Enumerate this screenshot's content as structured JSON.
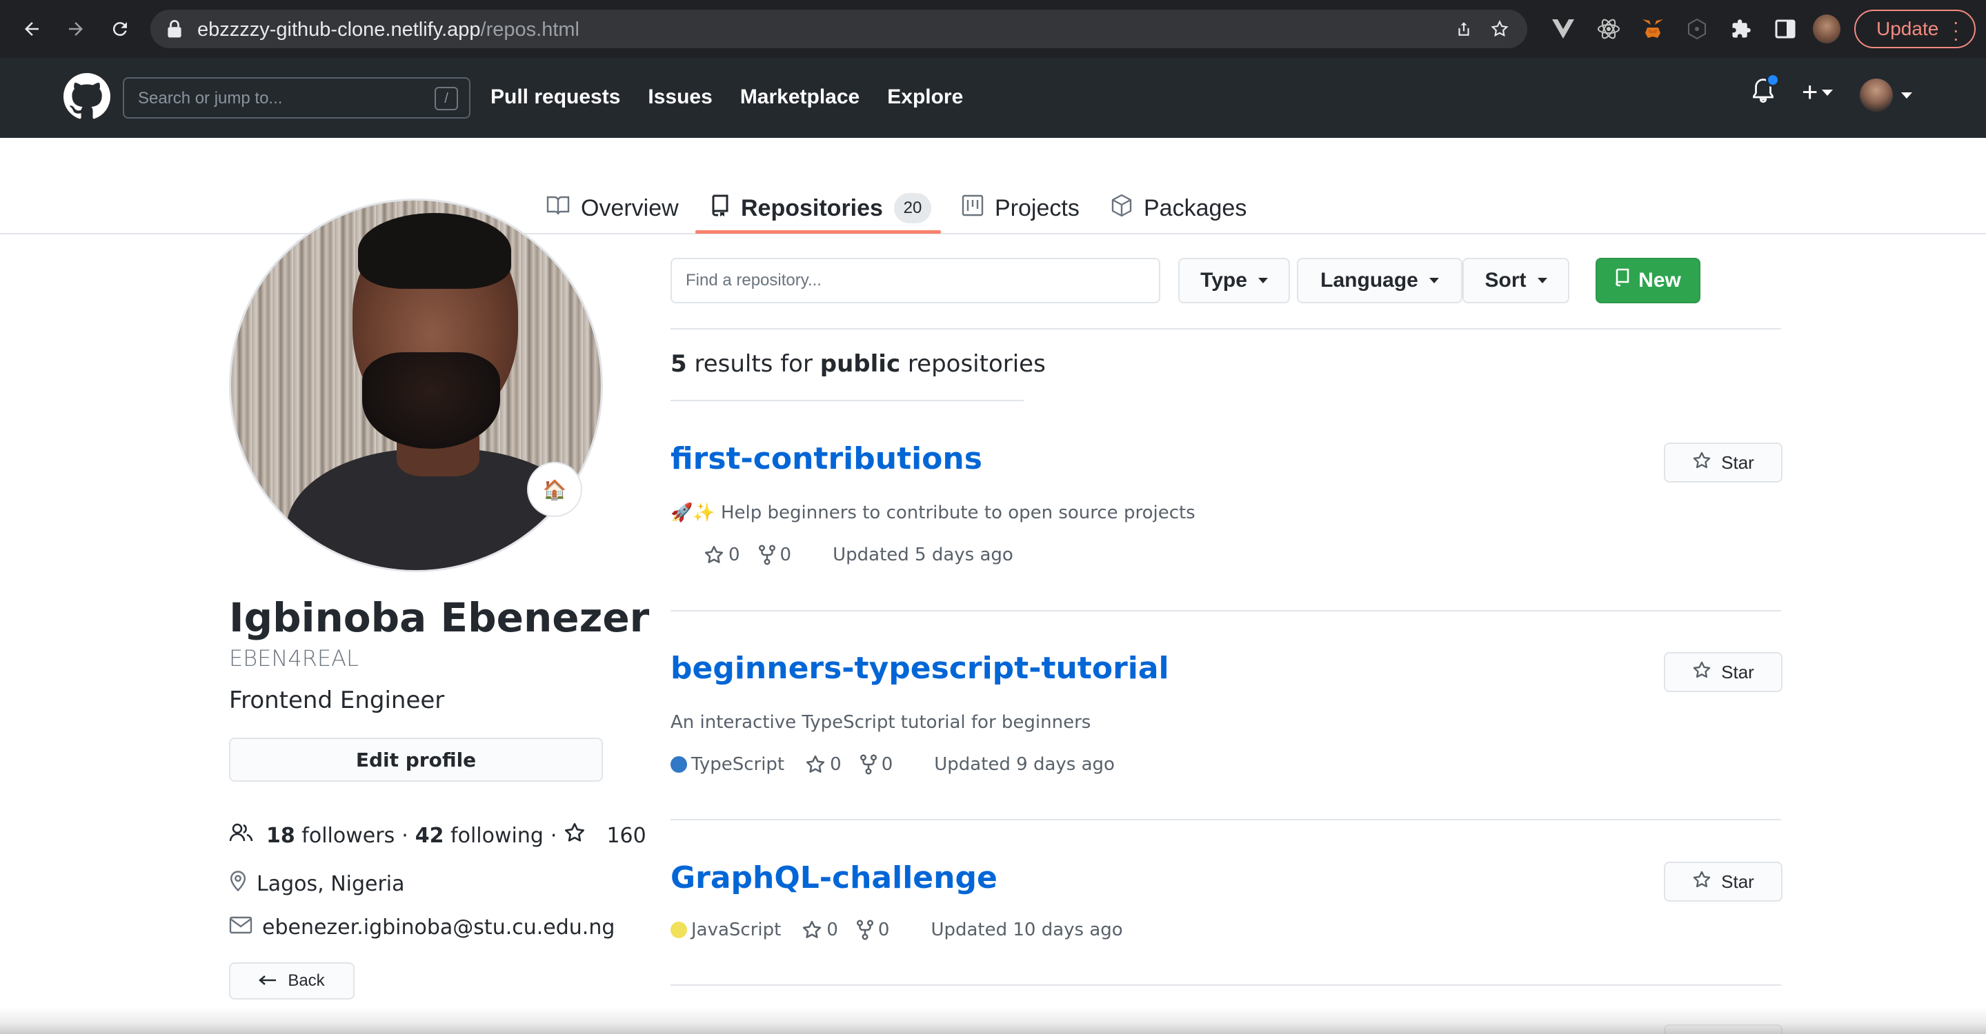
{
  "browser": {
    "url_host": "ebzzzzy-github-clone.netlify.app",
    "url_path": "/repos.html",
    "update_label": "Update"
  },
  "header": {
    "search_placeholder": "Search or jump to...",
    "search_shortcut": "/",
    "nav": [
      "Pull requests",
      "Issues",
      "Marketplace",
      "Explore"
    ]
  },
  "tabs": [
    {
      "label": "Overview",
      "icon": "book-icon"
    },
    {
      "label": "Repositories",
      "icon": "repo-icon",
      "count": "20",
      "active": true
    },
    {
      "label": "Projects",
      "icon": "project-icon"
    },
    {
      "label": "Packages",
      "icon": "package-icon"
    }
  ],
  "profile": {
    "name": "Igbinoba Ebenezer",
    "login": "EBEN4REAL",
    "bio": "Frontend Engineer",
    "edit_label": "Edit profile",
    "followers_count": "18",
    "followers_label": "followers",
    "following_count": "42",
    "following_label": "following",
    "stars": "160",
    "location": "Lagos, Nigeria",
    "email": "ebenezer.igbinoba@stu.cu.edu.ng",
    "back_label": "Back",
    "status_emoji": "🏠"
  },
  "filters": {
    "find_placeholder": "Find a repository...",
    "type_label": "Type",
    "language_label": "Language",
    "sort_label": "Sort",
    "new_label": "New"
  },
  "results": {
    "count": "5",
    "text_mid": "results for",
    "scope": "public",
    "text_end": "repositories"
  },
  "repos": [
    {
      "name": "first-contributions",
      "description": "🚀✨ Help beginners to contribute to open source projects",
      "language": "",
      "language_color": "",
      "stars": "0",
      "forks": "0",
      "updated": "Updated 5 days ago",
      "star_label": "Star"
    },
    {
      "name": "beginners-typescript-tutorial",
      "description": "An interactive TypeScript tutorial for beginners",
      "language": "TypeScript",
      "language_color": "#3178c6",
      "stars": "0",
      "forks": "0",
      "updated": "Updated 9 days ago",
      "star_label": "Star"
    },
    {
      "name": "GraphQL-challenge",
      "description": "",
      "language": "JavaScript",
      "language_color": "#f1e05a",
      "stars": "0",
      "forks": "0",
      "updated": "Updated 10 days ago",
      "star_label": "Star"
    }
  ],
  "colors": {
    "header_bg": "#24292e",
    "link_blue": "#0366d6",
    "new_green": "#2ea44f",
    "tab_underline": "#f9826c"
  }
}
